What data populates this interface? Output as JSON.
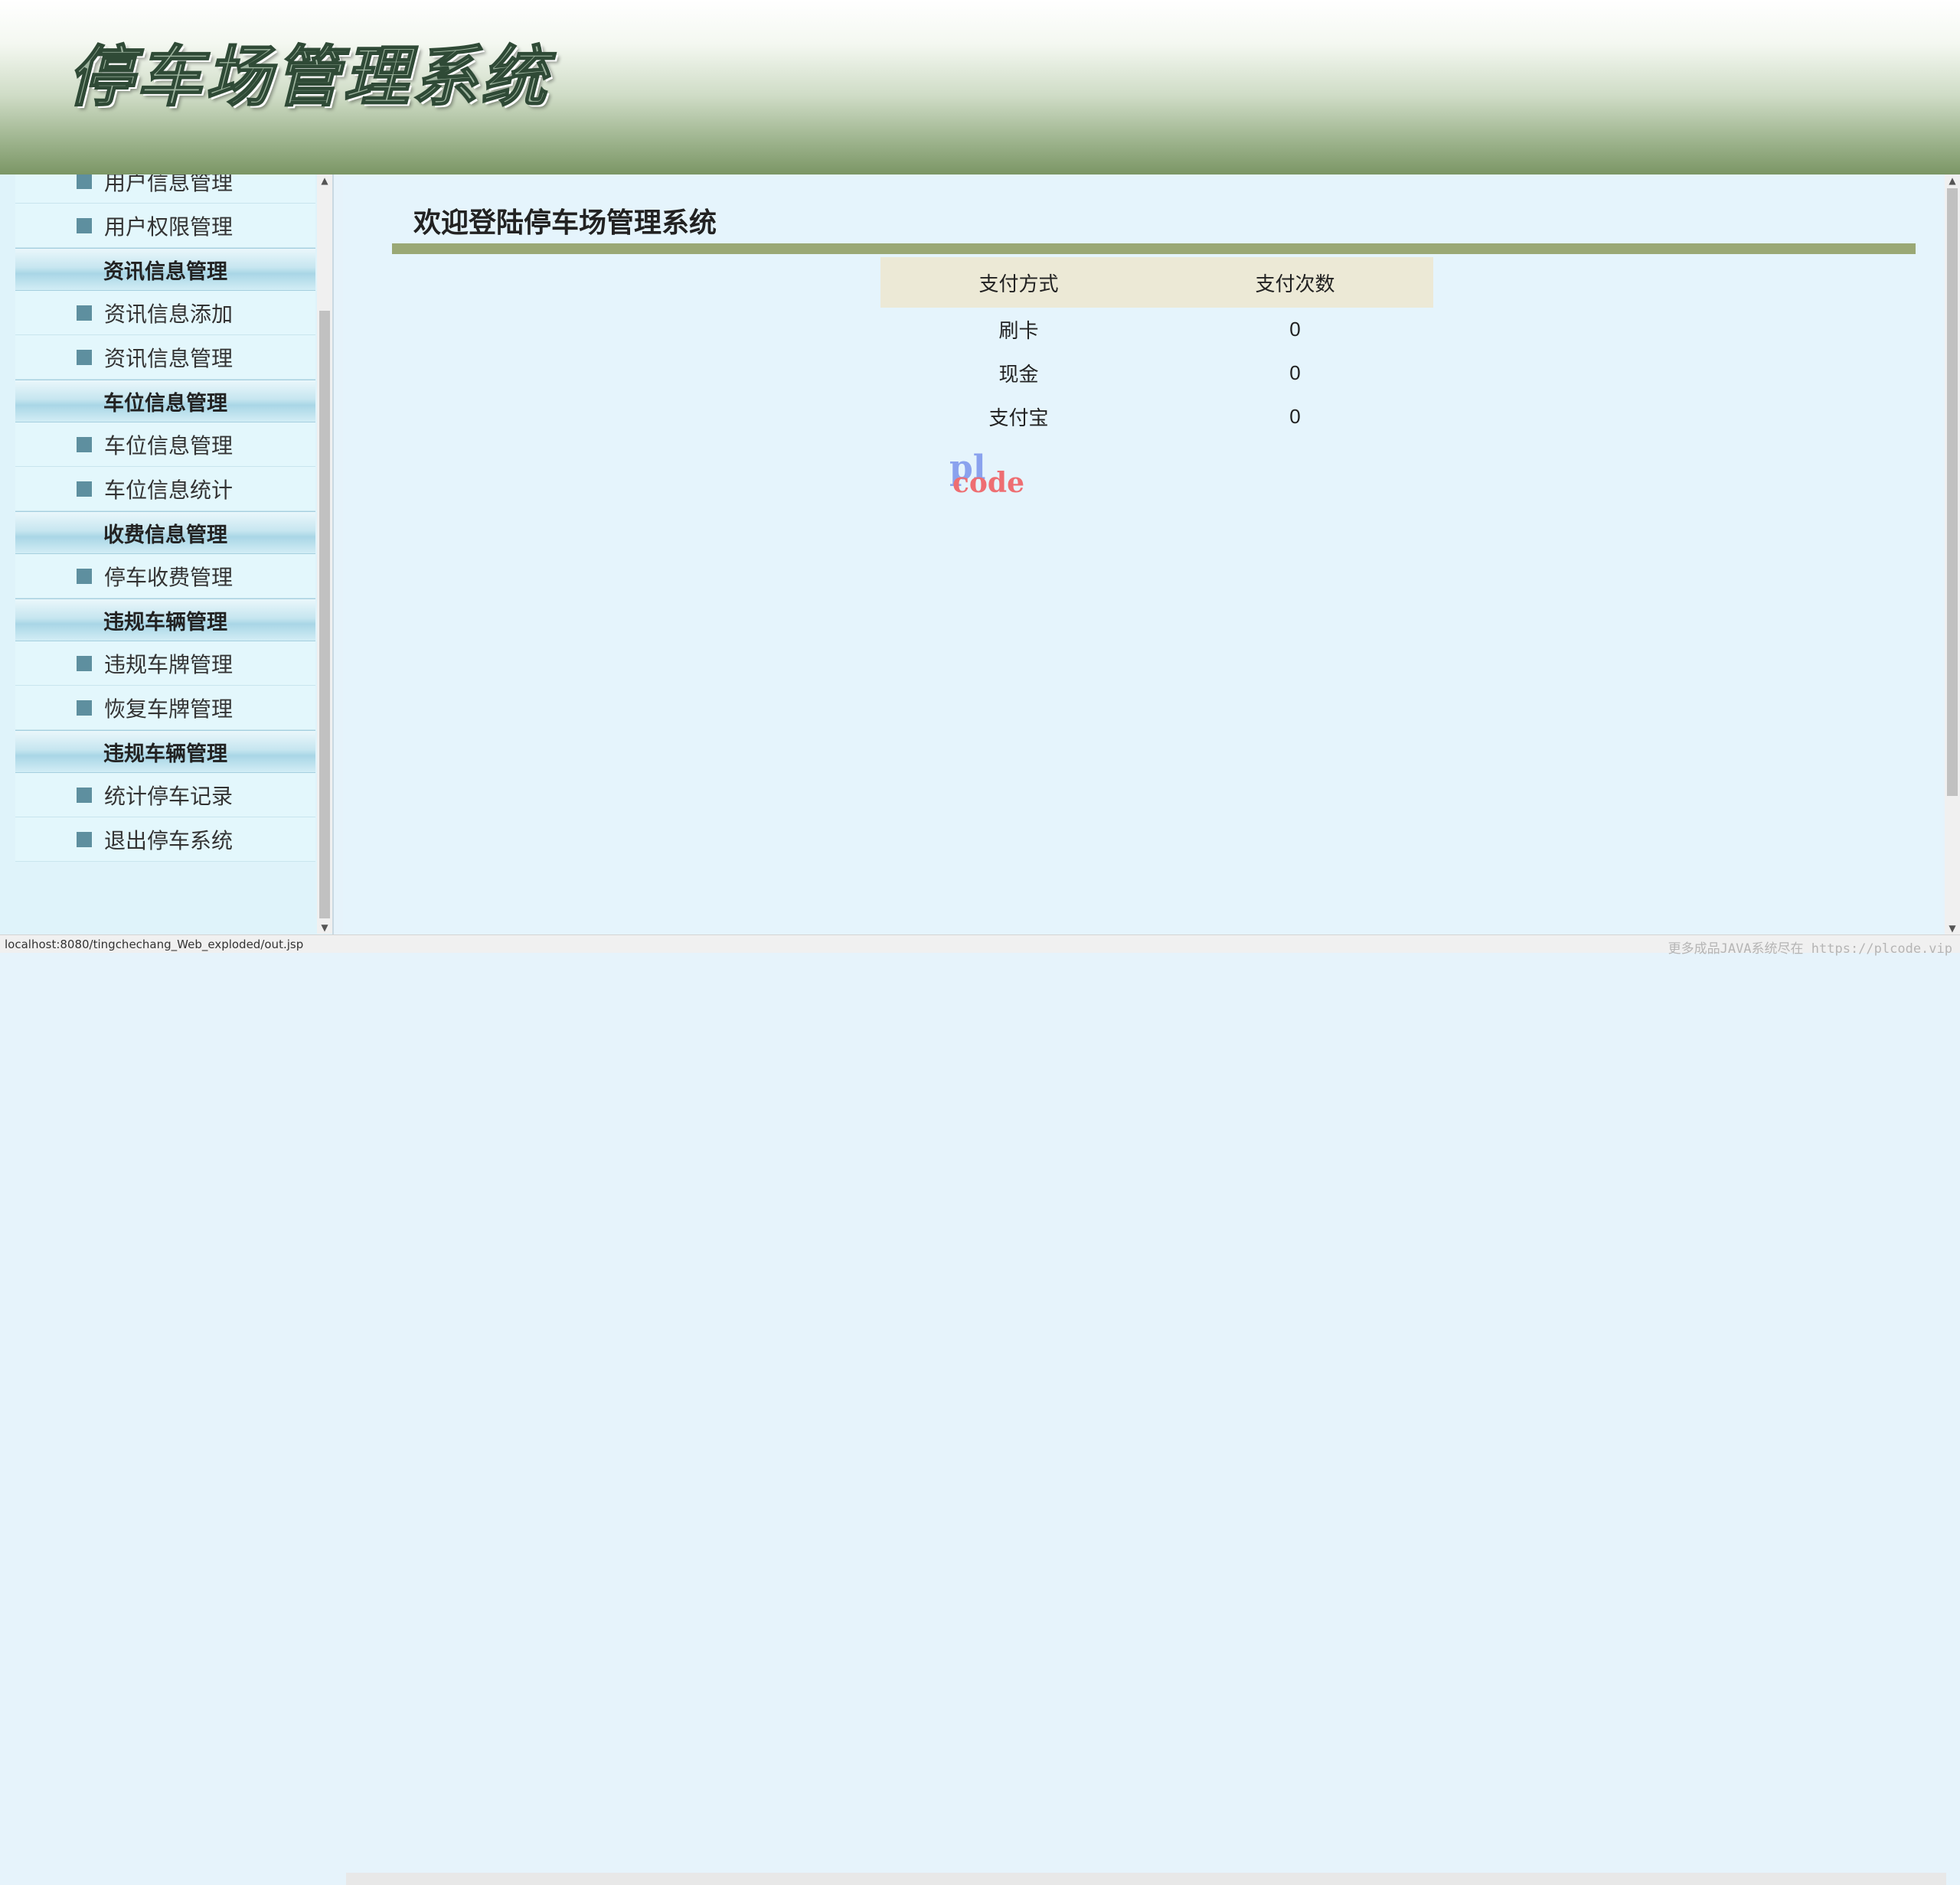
{
  "header": {
    "title": "停车场管理系统"
  },
  "menu": {
    "sections": [
      {
        "type": "item",
        "label": "用户信息管理"
      },
      {
        "type": "item",
        "label": "用户权限管理"
      },
      {
        "type": "group",
        "label": "资讯信息管理"
      },
      {
        "type": "item",
        "label": "资讯信息添加"
      },
      {
        "type": "item",
        "label": "资讯信息管理"
      },
      {
        "type": "group",
        "label": "车位信息管理"
      },
      {
        "type": "item",
        "label": "车位信息管理"
      },
      {
        "type": "item",
        "label": "车位信息统计"
      },
      {
        "type": "group",
        "label": "收费信息管理"
      },
      {
        "type": "item",
        "label": "停车收费管理"
      },
      {
        "type": "group",
        "label": "违规车辆管理"
      },
      {
        "type": "item",
        "label": "违规车牌管理"
      },
      {
        "type": "item",
        "label": "恢复车牌管理"
      },
      {
        "type": "group",
        "label": "违规车辆管理"
      },
      {
        "type": "item",
        "label": "统计停车记录"
      },
      {
        "type": "item",
        "label": "退出停车系统"
      }
    ]
  },
  "main": {
    "title": "欢迎登陆停车场管理系统",
    "table": {
      "headers": [
        "支付方式",
        "支付次数"
      ],
      "rows": [
        [
          "刷卡",
          "0"
        ],
        [
          "现金",
          "0"
        ],
        [
          "支付宝",
          "0"
        ]
      ]
    },
    "logo": {
      "line1": "pl",
      "line2": "code"
    }
  },
  "statusbar": {
    "url": "localhost:8080/tingchechang_Web_exploded/out.jsp",
    "watermark": "更多成品JAVA系统尽在 https://plcode.vip"
  },
  "colors": {
    "accent_bar": "#9aa875",
    "table_header": "#ece9d6",
    "menu_bullet": "#5e8f9f"
  }
}
